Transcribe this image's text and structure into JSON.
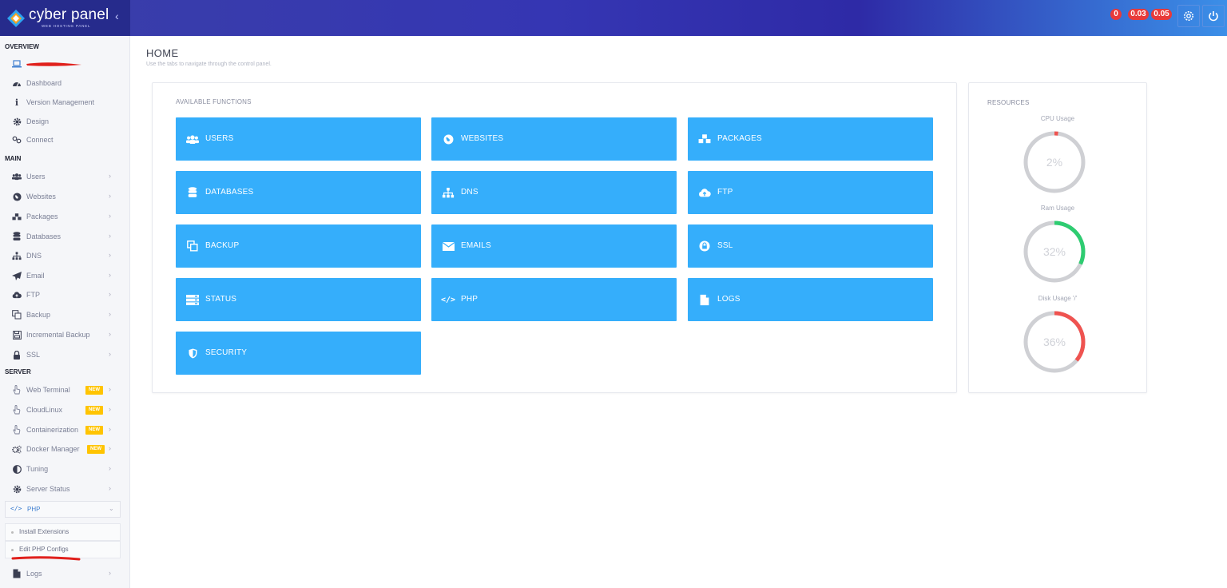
{
  "brand": {
    "name": "cyber panel",
    "tagline": "WEB HOSTING PANEL"
  },
  "topbar": {
    "badges": [
      "0",
      "0.03",
      "0.05"
    ],
    "settings_icon": "gear-icon",
    "power_icon": "power-icon"
  },
  "sidebar": {
    "overview_heading": "OVERVIEW",
    "overview_items": [
      {
        "label": "",
        "icon": "laptop-icon"
      },
      {
        "label": "Dashboard",
        "icon": "dashboard-icon"
      },
      {
        "label": "Version Management",
        "icon": "info-icon"
      },
      {
        "label": "Design",
        "icon": "cog-icon"
      },
      {
        "label": "Connect",
        "icon": "link-icon"
      }
    ],
    "main_heading": "MAIN",
    "main_items": [
      {
        "label": "Users",
        "icon": "users-icon"
      },
      {
        "label": "Websites",
        "icon": "globe-icon"
      },
      {
        "label": "Packages",
        "icon": "cubes-icon"
      },
      {
        "label": "Databases",
        "icon": "database-icon"
      },
      {
        "label": "DNS",
        "icon": "sitemap-icon"
      },
      {
        "label": "Email",
        "icon": "paper-plane-icon"
      },
      {
        "label": "FTP",
        "icon": "cloud-upload-icon"
      },
      {
        "label": "Backup",
        "icon": "copy-icon"
      },
      {
        "label": "Incremental Backup",
        "icon": "save-icon"
      },
      {
        "label": "SSL",
        "icon": "lock-icon"
      }
    ],
    "server_heading": "SERVER",
    "server_items": [
      {
        "label": "Web Terminal",
        "icon": "hand-pointer-icon",
        "badge": "NEW"
      },
      {
        "label": "CloudLinux",
        "icon": "hand-pointer-icon",
        "badge": "NEW"
      },
      {
        "label": "Containerization",
        "icon": "hand-pointer-icon",
        "badge": "NEW"
      },
      {
        "label": "Docker Manager",
        "icon": "cogs-icon",
        "badge": "NEW"
      },
      {
        "label": "Tuning",
        "icon": "adjust-icon"
      },
      {
        "label": "Server Status",
        "icon": "cog-icon"
      }
    ],
    "php_label": "PHP",
    "php_subitems": [
      "Install Extensions",
      "Edit PHP Configs"
    ],
    "logs_label": "Logs"
  },
  "main": {
    "title": "HOME",
    "subtitle": "Use the tabs to navigate through the control panel.",
    "functions_heading": "AVAILABLE FUNCTIONS",
    "tiles": [
      {
        "label": "USERS",
        "icon": "users-icon"
      },
      {
        "label": "WEBSITES",
        "icon": "globe-icon"
      },
      {
        "label": "PACKAGES",
        "icon": "cubes-icon"
      },
      {
        "label": "DATABASES",
        "icon": "database-icon"
      },
      {
        "label": "DNS",
        "icon": "sitemap-icon"
      },
      {
        "label": "FTP",
        "icon": "cloud-upload-icon"
      },
      {
        "label": "BACKUP",
        "icon": "copy-icon"
      },
      {
        "label": "EMAILS",
        "icon": "envelope-icon"
      },
      {
        "label": "SSL",
        "icon": "lock-icon"
      },
      {
        "label": "STATUS",
        "icon": "server-icon"
      },
      {
        "label": "PHP",
        "icon": "code-icon"
      },
      {
        "label": "LOGS",
        "icon": "file-icon"
      },
      {
        "label": "SECURITY",
        "icon": "shield-icon"
      }
    ]
  },
  "resources": {
    "heading": "RESOURCES",
    "gauges": [
      {
        "label": "CPU Usage",
        "value": "2%",
        "percent": 2,
        "color": "#ef5350"
      },
      {
        "label": "Ram Usage",
        "value": "32%",
        "percent": 32,
        "color": "#2ecc71"
      },
      {
        "label": "Disk Usage '/'",
        "value": "36%",
        "percent": 36,
        "color": "#ef5350"
      }
    ]
  },
  "colors": {
    "accent": "#35aefb",
    "topbar": "#3536b3",
    "badge": "#e83a3a",
    "new_badge": "#ffc400"
  }
}
